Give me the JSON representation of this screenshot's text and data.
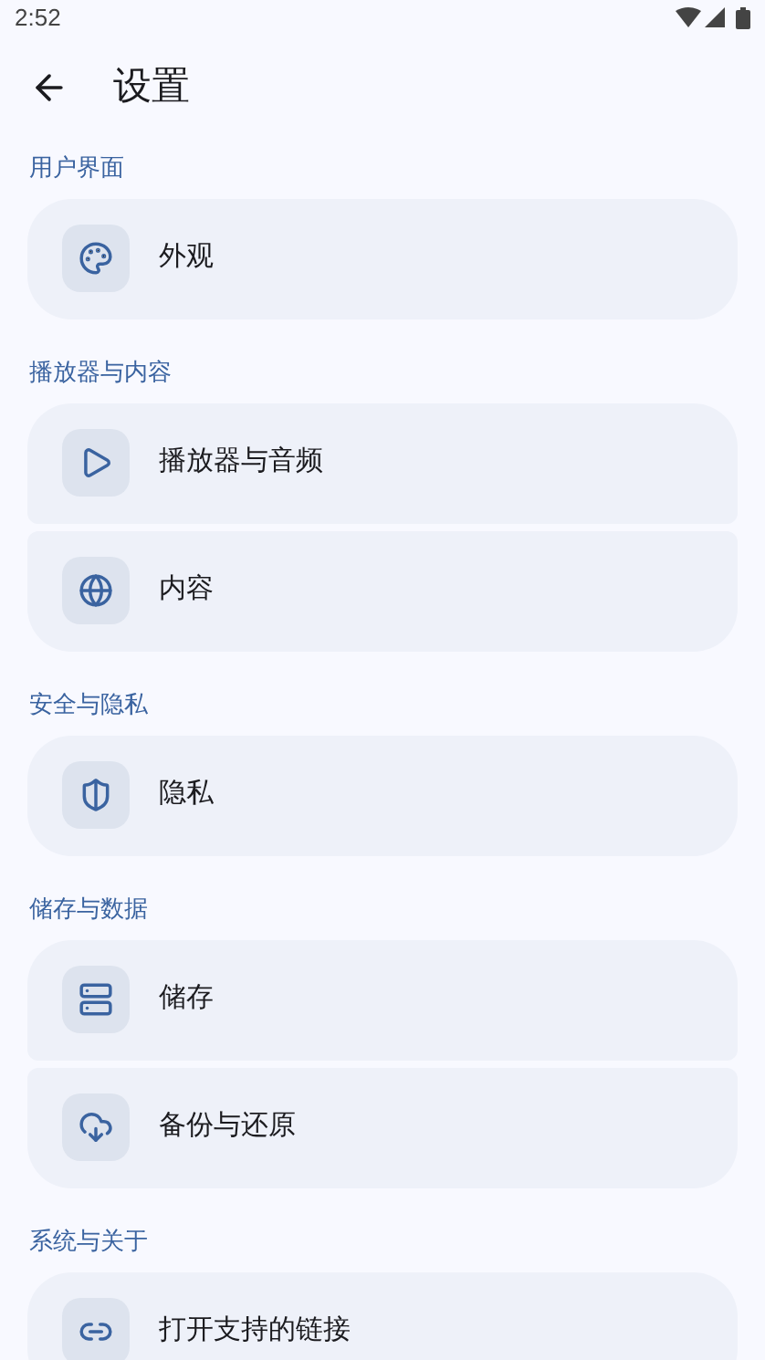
{
  "status_bar": {
    "time": "2:52"
  },
  "app_bar": {
    "title": "设置"
  },
  "sections": [
    {
      "title": "用户界面",
      "items": [
        {
          "label": "外观"
        }
      ]
    },
    {
      "title": "播放器与内容",
      "items": [
        {
          "label": "播放器与音频"
        },
        {
          "label": "内容"
        }
      ]
    },
    {
      "title": "安全与隐私",
      "items": [
        {
          "label": "隐私"
        }
      ]
    },
    {
      "title": "储存与数据",
      "items": [
        {
          "label": "储存"
        },
        {
          "label": "备份与还原"
        }
      ]
    },
    {
      "title": "系统与关于",
      "items": [
        {
          "label": "打开支持的链接"
        }
      ]
    }
  ]
}
